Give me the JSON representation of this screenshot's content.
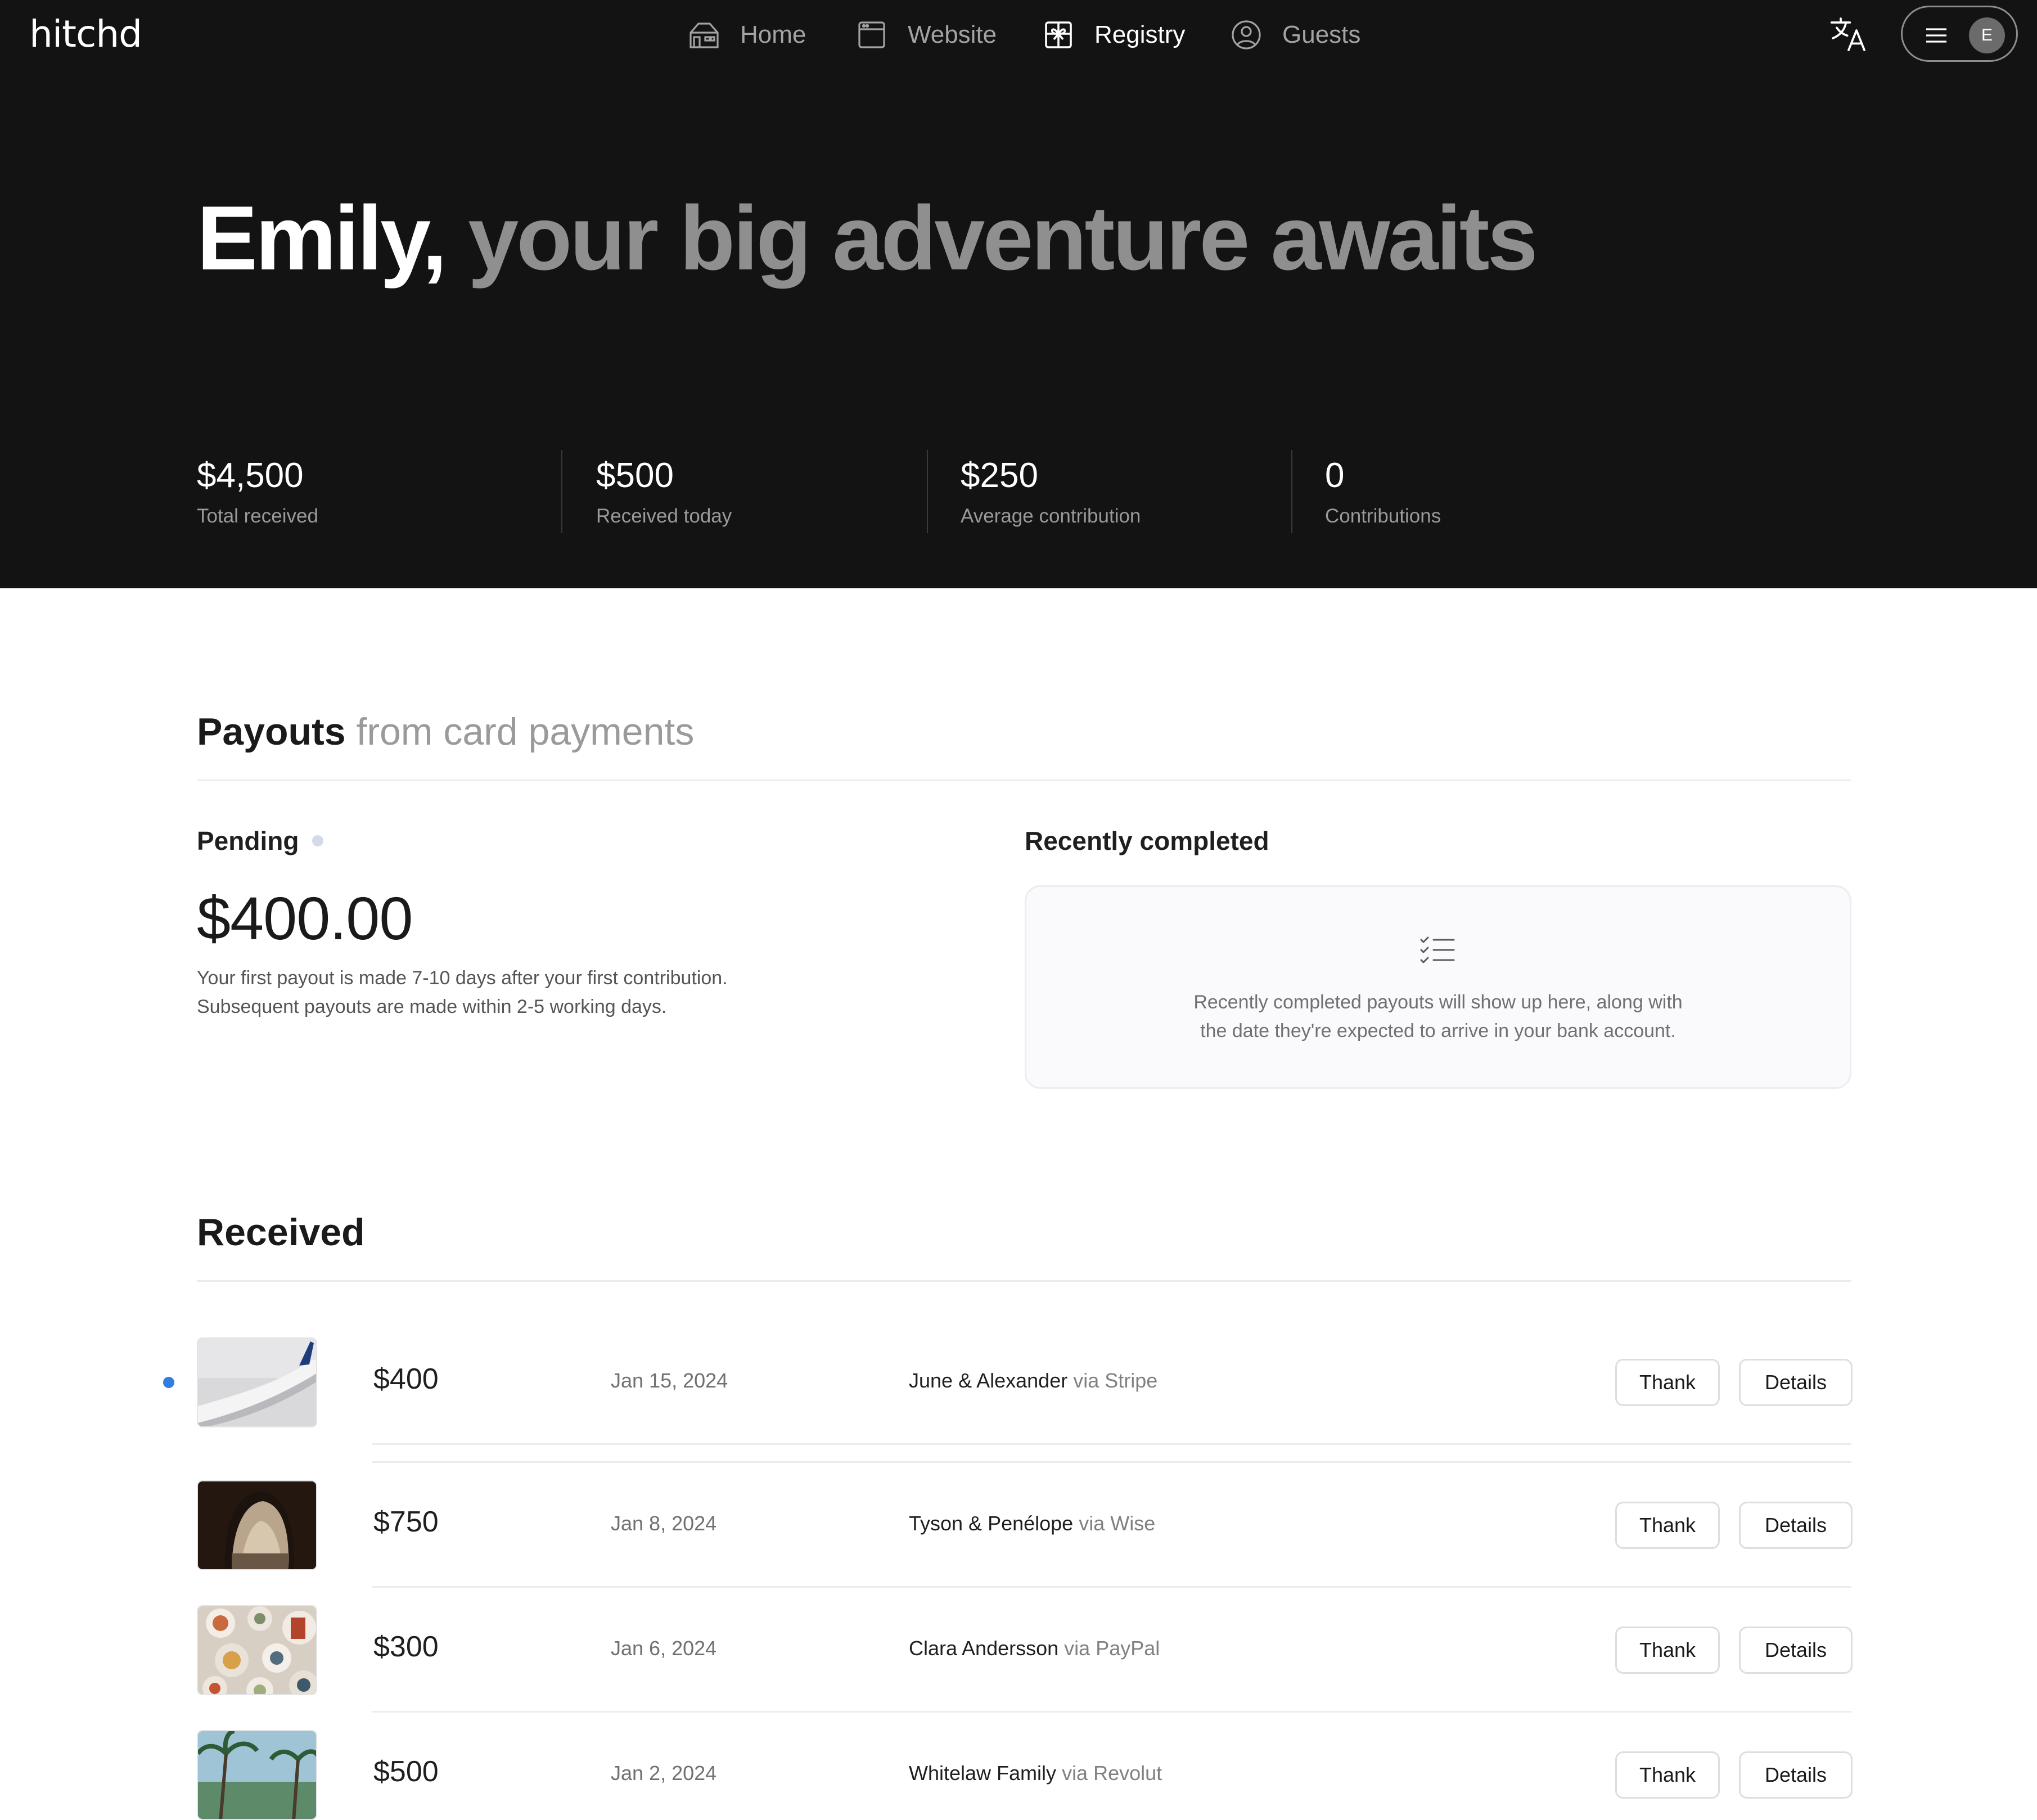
{
  "app": {
    "logo": "hitchd"
  },
  "nav": {
    "items": [
      {
        "label": "Home",
        "icon": "house-icon",
        "active": false
      },
      {
        "label": "Website",
        "icon": "browser-window-icon",
        "active": false
      },
      {
        "label": "Registry",
        "icon": "gift-icon",
        "active": true
      },
      {
        "label": "Guests",
        "icon": "user-circle-icon",
        "active": false
      }
    ],
    "translate_icon": "translate-icon",
    "menu_icon": "hamburger-menu-icon",
    "avatar_initial": "E"
  },
  "hero": {
    "name": "Emily,",
    "rest": " your big adventure awaits"
  },
  "stats": [
    {
      "value": "$4,500",
      "caption": "Total received"
    },
    {
      "value": "$500",
      "caption": "Received today"
    },
    {
      "value": "$250",
      "caption": "Average contribution"
    },
    {
      "value": "0",
      "caption": "Contributions"
    }
  ],
  "payouts": {
    "title": "Payouts",
    "subtitle": "from card payments",
    "pending": {
      "label": "Pending",
      "amount": "$400.00",
      "note_line1": "Your first payout is made 7-10 days after your first contribution.",
      "note_line2": "Subsequent payouts are made within 2-5 working days."
    },
    "recent": {
      "label": "Recently completed",
      "icon": "checklist-icon",
      "message_line1": "Recently completed payouts will show up here, along with",
      "message_line2": "the date they're expected to arrive in your bank account."
    }
  },
  "received": {
    "title": "Received",
    "thank_label": "Thank",
    "details_label": "Details",
    "rows": [
      {
        "amount": "$400",
        "date": "Jan 15, 2024",
        "name": "June & Alexander",
        "via": "via Stripe",
        "new": true,
        "image": "airplane-wing"
      },
      {
        "amount": "$750",
        "date": "Jan 8, 2024",
        "name": "Tyson & Penélope",
        "via": "via Wise",
        "new": false,
        "image": "sea-cave"
      },
      {
        "amount": "$300",
        "date": "Jan 6, 2024",
        "name": "Clara Andersson",
        "via": "via PayPal",
        "new": false,
        "image": "food-table"
      },
      {
        "amount": "$500",
        "date": "Jan 2, 2024",
        "name": "Whitelaw Family",
        "via": "via Revolut",
        "new": false,
        "image": "palm-trees"
      }
    ]
  },
  "colors": {
    "dark_bg": "#131313",
    "accent_dot": "#2f7fe0",
    "muted_text": "#8f8f8f"
  }
}
